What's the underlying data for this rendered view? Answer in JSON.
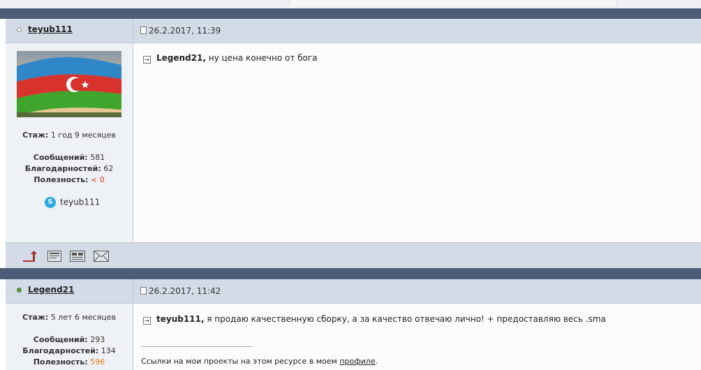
{
  "posts": [
    {
      "author": "teyub111",
      "status": "offline",
      "date": "26.2.2017, 11:39",
      "avatar": "azerbaijan-flag",
      "stazh_label": "Стаж:",
      "stazh_value": "1 год 9 месяцев",
      "messages_label": "Сообщений:",
      "messages_value": "581",
      "thanks_label": "Благодарностей:",
      "thanks_value": "62",
      "useful_label": "Полезность:",
      "useful_value": "< 0",
      "skype_name": "teyub111",
      "quote_name": "Legend21,",
      "text": "ну цена конечно от бога"
    },
    {
      "author": "Legend21",
      "status": "online",
      "date": "26.2.2017, 11:42",
      "stazh_label": "Стаж:",
      "stazh_value": "5 лет 6 месяцев",
      "messages_label": "Сообщений:",
      "messages_value": "293",
      "thanks_label": "Благодарностей:",
      "thanks_value": "134",
      "useful_label": "Полезность:",
      "useful_value": "596",
      "quote_name": "teyub111,",
      "text": "я продаю качественную сборку, а за качество отвечаю лично! + предоставляю весь .sma",
      "signature_prefix": "Ссылки на мои проекты на этом ресурсе в моем",
      "signature_link": "профиле",
      "signature_suffix": "."
    }
  ],
  "toolbar_icons": [
    "go-top-icon",
    "pm-icon",
    "profile-card-icon",
    "email-icon"
  ],
  "colors": {
    "header_bar": "#4d5d77",
    "post_head": "#d3dbe6",
    "sidebar": "#eef1f5",
    "negative": "#d23b1e",
    "positive": "#e07b14",
    "online": "#5a9b3c"
  }
}
